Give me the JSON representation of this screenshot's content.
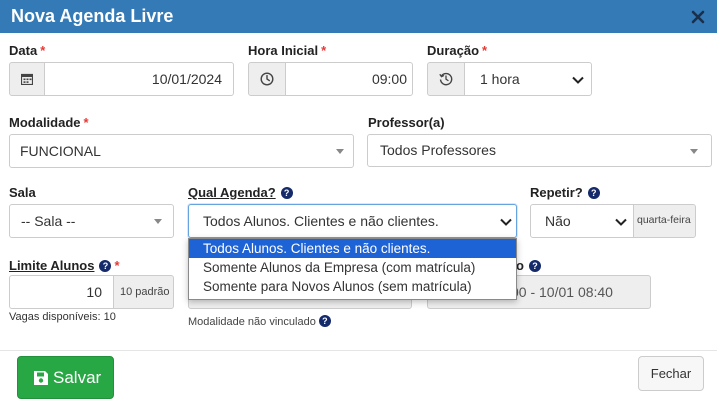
{
  "modal": {
    "title": "Nova Agenda Livre"
  },
  "fields": {
    "data": {
      "label": "Data",
      "value": "10/01/2024"
    },
    "hora_inicial": {
      "label": "Hora Inicial",
      "value": "09:00"
    },
    "duracao": {
      "label": "Duração",
      "value": "1 hora"
    },
    "modalidade": {
      "label": "Modalidade",
      "value": "FUNCIONAL"
    },
    "professor": {
      "label": "Professor(a)",
      "value": "Todos Professores"
    },
    "sala": {
      "label": "Sala",
      "value": "-- Sala --"
    },
    "qual_agenda": {
      "label": "Qual Agenda?",
      "value": "Todos Alunos. Clientes e não clientes.",
      "options": [
        "Todos Alunos. Clientes e não clientes.",
        "Somente Alunos da Empresa (com matrícula)",
        "Somente para Novos Alunos (sem matrícula)"
      ],
      "note": "Modalidade não vinculado"
    },
    "repetir": {
      "label": "Repetir?",
      "value": "Não",
      "addon": "quarta-feira"
    },
    "limite_alunos": {
      "label": "Limite Alunos",
      "value": "10",
      "addon": "10 padrão",
      "note": "Vagas disponíveis: 10"
    },
    "partial_label_suffix": "o",
    "period_value": "00 - 10/01 08:40"
  },
  "buttons": {
    "save": "Salvar",
    "close": "Fechar"
  },
  "colors": {
    "header": "#337ab7",
    "required": "#e53935",
    "save": "#28a745",
    "selection": "#1e63d6"
  }
}
